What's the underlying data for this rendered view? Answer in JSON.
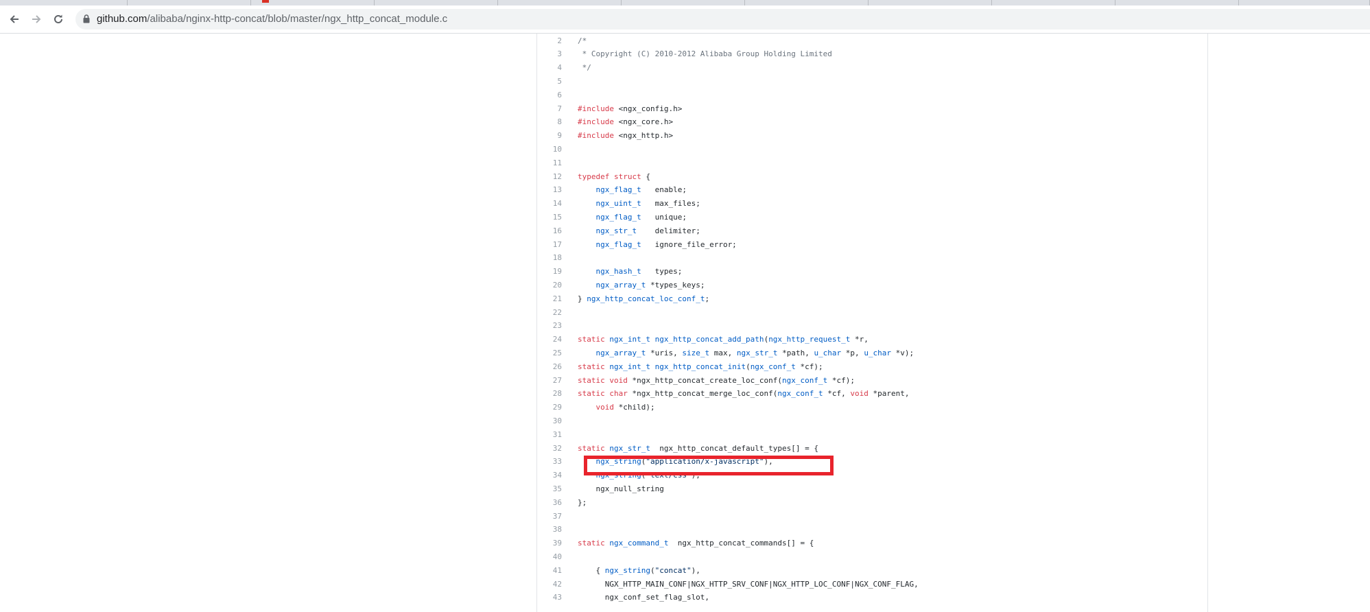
{
  "browser": {
    "url_host": "github.com",
    "url_path": "/alibaba/nginx-http-concat/blob/master/ngx_http_concat_module.c"
  },
  "code_lines": [
    {
      "n": "2",
      "parts": [
        {
          "c": "/*",
          "k": "c"
        }
      ]
    },
    {
      "n": "3",
      "parts": [
        {
          "c": " * Copyright (C) 2010-2012 Alibaba Group Holding Limited",
          "k": "c"
        }
      ]
    },
    {
      "n": "4",
      "parts": [
        {
          "c": " */",
          "k": "c"
        }
      ]
    },
    {
      "n": "5",
      "parts": []
    },
    {
      "n": "6",
      "parts": []
    },
    {
      "n": "7",
      "parts": [
        {
          "c": "#include",
          "k": "k"
        },
        {
          "c": " <ngx_config.h>",
          "k": ""
        }
      ]
    },
    {
      "n": "8",
      "parts": [
        {
          "c": "#include",
          "k": "k"
        },
        {
          "c": " <ngx_core.h>",
          "k": ""
        }
      ]
    },
    {
      "n": "9",
      "parts": [
        {
          "c": "#include",
          "k": "k"
        },
        {
          "c": " <ngx_http.h>",
          "k": ""
        }
      ]
    },
    {
      "n": "10",
      "parts": []
    },
    {
      "n": "11",
      "parts": []
    },
    {
      "n": "12",
      "parts": [
        {
          "c": "typedef",
          "k": "k"
        },
        {
          "c": " ",
          "k": ""
        },
        {
          "c": "struct",
          "k": "k"
        },
        {
          "c": " {",
          "k": ""
        }
      ]
    },
    {
      "n": "13",
      "parts": [
        {
          "c": "    ",
          "k": ""
        },
        {
          "c": "ngx_flag_t",
          "k": "t"
        },
        {
          "c": "   enable;",
          "k": ""
        }
      ]
    },
    {
      "n": "14",
      "parts": [
        {
          "c": "    ",
          "k": ""
        },
        {
          "c": "ngx_uint_t",
          "k": "t"
        },
        {
          "c": "   max_files;",
          "k": ""
        }
      ]
    },
    {
      "n": "15",
      "parts": [
        {
          "c": "    ",
          "k": ""
        },
        {
          "c": "ngx_flag_t",
          "k": "t"
        },
        {
          "c": "   unique;",
          "k": ""
        }
      ]
    },
    {
      "n": "16",
      "parts": [
        {
          "c": "    ",
          "k": ""
        },
        {
          "c": "ngx_str_t",
          "k": "t"
        },
        {
          "c": "    delimiter;",
          "k": ""
        }
      ]
    },
    {
      "n": "17",
      "parts": [
        {
          "c": "    ",
          "k": ""
        },
        {
          "c": "ngx_flag_t",
          "k": "t"
        },
        {
          "c": "   ignore_file_error;",
          "k": ""
        }
      ]
    },
    {
      "n": "18",
      "parts": []
    },
    {
      "n": "19",
      "parts": [
        {
          "c": "    ",
          "k": ""
        },
        {
          "c": "ngx_hash_t",
          "k": "t"
        },
        {
          "c": "   types;",
          "k": ""
        }
      ]
    },
    {
      "n": "20",
      "parts": [
        {
          "c": "    ",
          "k": ""
        },
        {
          "c": "ngx_array_t",
          "k": "t"
        },
        {
          "c": " *types_keys;",
          "k": ""
        }
      ]
    },
    {
      "n": "21",
      "parts": [
        {
          "c": "} ",
          "k": ""
        },
        {
          "c": "ngx_http_concat_loc_conf_t",
          "k": "t"
        },
        {
          "c": ";",
          "k": ""
        }
      ]
    },
    {
      "n": "22",
      "parts": []
    },
    {
      "n": "23",
      "parts": []
    },
    {
      "n": "24",
      "parts": [
        {
          "c": "static",
          "k": "k"
        },
        {
          "c": " ",
          "k": ""
        },
        {
          "c": "ngx_int_t",
          "k": "t"
        },
        {
          "c": " ",
          "k": ""
        },
        {
          "c": "ngx_http_concat_add_path",
          "k": "t"
        },
        {
          "c": "(",
          "k": ""
        },
        {
          "c": "ngx_http_request_t",
          "k": "t"
        },
        {
          "c": " *r,",
          "k": ""
        }
      ]
    },
    {
      "n": "25",
      "parts": [
        {
          "c": "    ",
          "k": ""
        },
        {
          "c": "ngx_array_t",
          "k": "t"
        },
        {
          "c": " *uris, ",
          "k": ""
        },
        {
          "c": "size_t",
          "k": "t"
        },
        {
          "c": " max, ",
          "k": ""
        },
        {
          "c": "ngx_str_t",
          "k": "t"
        },
        {
          "c": " *path, ",
          "k": ""
        },
        {
          "c": "u_char",
          "k": "t"
        },
        {
          "c": " *p, ",
          "k": ""
        },
        {
          "c": "u_char",
          "k": "t"
        },
        {
          "c": " *v);",
          "k": ""
        }
      ]
    },
    {
      "n": "26",
      "parts": [
        {
          "c": "static",
          "k": "k"
        },
        {
          "c": " ",
          "k": ""
        },
        {
          "c": "ngx_int_t",
          "k": "t"
        },
        {
          "c": " ",
          "k": ""
        },
        {
          "c": "ngx_http_concat_init",
          "k": "t"
        },
        {
          "c": "(",
          "k": ""
        },
        {
          "c": "ngx_conf_t",
          "k": "t"
        },
        {
          "c": " *cf);",
          "k": ""
        }
      ]
    },
    {
      "n": "27",
      "parts": [
        {
          "c": "static",
          "k": "k"
        },
        {
          "c": " ",
          "k": ""
        },
        {
          "c": "void",
          "k": "k"
        },
        {
          "c": " *ngx_http_concat_create_loc_conf(",
          "k": ""
        },
        {
          "c": "ngx_conf_t",
          "k": "t"
        },
        {
          "c": " *cf);",
          "k": ""
        }
      ]
    },
    {
      "n": "28",
      "parts": [
        {
          "c": "static",
          "k": "k"
        },
        {
          "c": " ",
          "k": ""
        },
        {
          "c": "char",
          "k": "k"
        },
        {
          "c": " *ngx_http_concat_merge_loc_conf(",
          "k": ""
        },
        {
          "c": "ngx_conf_t",
          "k": "t"
        },
        {
          "c": " *cf, ",
          "k": ""
        },
        {
          "c": "void",
          "k": "k"
        },
        {
          "c": " *parent,",
          "k": ""
        }
      ]
    },
    {
      "n": "29",
      "parts": [
        {
          "c": "    ",
          "k": ""
        },
        {
          "c": "void",
          "k": "k"
        },
        {
          "c": " *child);",
          "k": ""
        }
      ]
    },
    {
      "n": "30",
      "parts": []
    },
    {
      "n": "31",
      "parts": []
    },
    {
      "n": "32",
      "parts": [
        {
          "c": "static",
          "k": "k"
        },
        {
          "c": " ",
          "k": ""
        },
        {
          "c": "ngx_str_t",
          "k": "t"
        },
        {
          "c": "  ngx_http_concat_default_types[] = {",
          "k": ""
        }
      ]
    },
    {
      "n": "33",
      "parts": [
        {
          "c": "    ",
          "k": ""
        },
        {
          "c": "ngx_string",
          "k": "t"
        },
        {
          "c": "(",
          "k": ""
        },
        {
          "c": "\"application/x-javascript\"",
          "k": "s"
        },
        {
          "c": "),",
          "k": ""
        }
      ]
    },
    {
      "n": "34",
      "parts": [
        {
          "c": "    ",
          "k": ""
        },
        {
          "c": "ngx_string",
          "k": "t"
        },
        {
          "c": "(",
          "k": ""
        },
        {
          "c": "\"text/css\"",
          "k": "s"
        },
        {
          "c": "),",
          "k": ""
        }
      ]
    },
    {
      "n": "35",
      "parts": [
        {
          "c": "    ngx_null_string",
          "k": ""
        }
      ]
    },
    {
      "n": "36",
      "parts": [
        {
          "c": "};",
          "k": ""
        }
      ]
    },
    {
      "n": "37",
      "parts": []
    },
    {
      "n": "38",
      "parts": []
    },
    {
      "n": "39",
      "parts": [
        {
          "c": "static",
          "k": "k"
        },
        {
          "c": " ",
          "k": ""
        },
        {
          "c": "ngx_command_t",
          "k": "t"
        },
        {
          "c": "  ngx_http_concat_commands[] = {",
          "k": ""
        }
      ]
    },
    {
      "n": "40",
      "parts": []
    },
    {
      "n": "41",
      "parts": [
        {
          "c": "    { ",
          "k": ""
        },
        {
          "c": "ngx_string",
          "k": "t"
        },
        {
          "c": "(",
          "k": ""
        },
        {
          "c": "\"concat\"",
          "k": "s"
        },
        {
          "c": "),",
          "k": ""
        }
      ]
    },
    {
      "n": "42",
      "parts": [
        {
          "c": "      NGX_HTTP_MAIN_CONF|NGX_HTTP_SRV_CONF|NGX_HTTP_LOC_CONF|NGX_CONF_FLAG,",
          "k": ""
        }
      ]
    },
    {
      "n": "43",
      "parts": [
        {
          "c": "      ngx_conf_set_flag_slot,",
          "k": ""
        }
      ]
    }
  ]
}
